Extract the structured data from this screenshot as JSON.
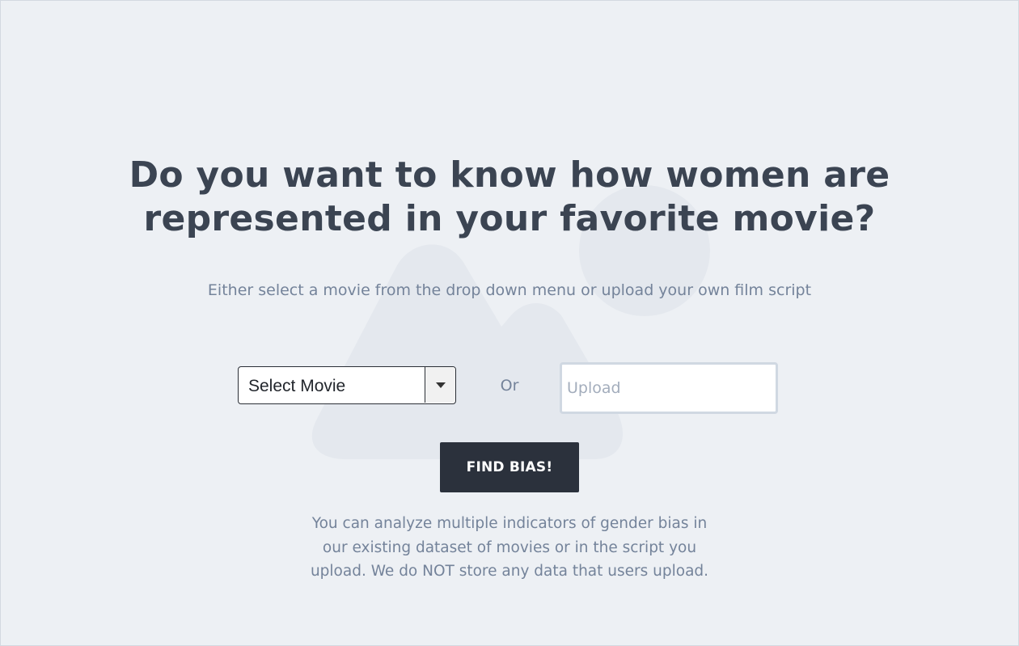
{
  "hero": {
    "title_line1": "Do you want to know how women are",
    "title_line2": "represented in your favorite movie?",
    "subtitle": "Either select a movie from the drop down menu or upload your own film script"
  },
  "form": {
    "select": {
      "selected_value": "Select Movie"
    },
    "or_label": "Or",
    "upload": {
      "value": "",
      "placeholder": "Upload"
    },
    "submit_label": "FIND BIAS!"
  },
  "note": {
    "line1": "You can analyze multiple indicators of gender bias in",
    "line2": "our existing dataset of movies or in the script you",
    "line3": "upload. We do NOT store any data that users upload."
  },
  "colors": {
    "background": "#edf0f4",
    "heading": "#3b4452",
    "muted_text": "#74839a",
    "button": "#2b313c"
  },
  "icons": {
    "background_art": "mountain-sun-image-placeholder-icon",
    "select_arrow": "caret-down-icon"
  }
}
